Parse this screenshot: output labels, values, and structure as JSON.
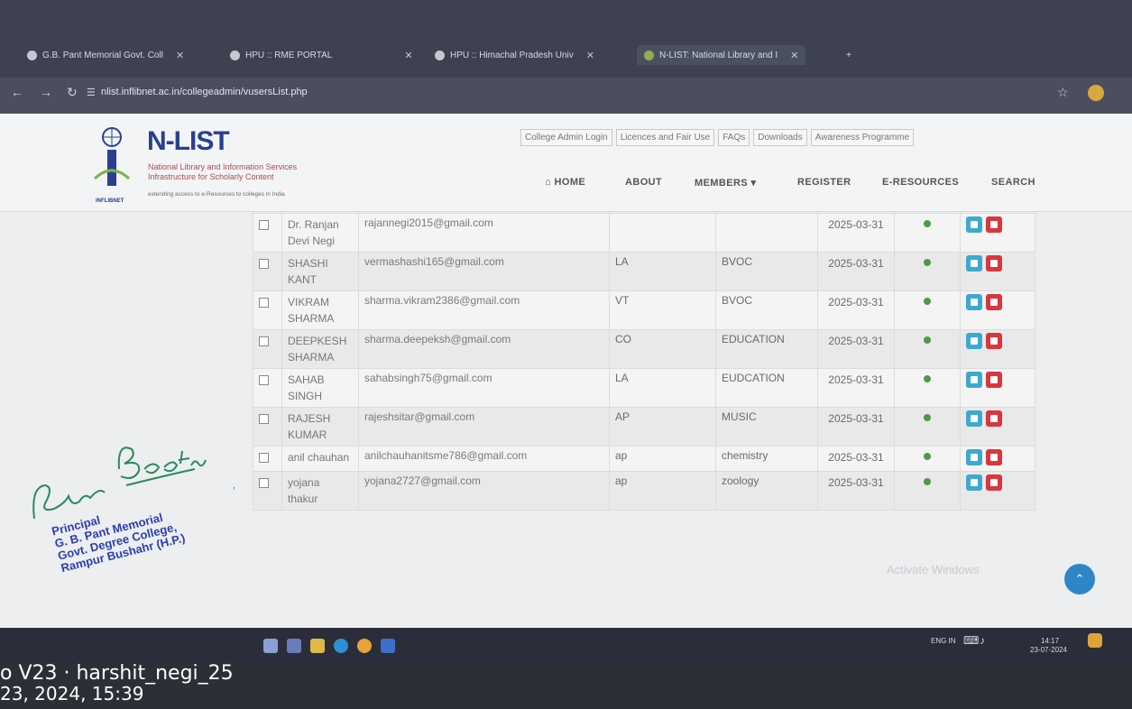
{
  "browser": {
    "tabs": [
      {
        "label": "G.B. Pant Memorial Govt. Coll"
      },
      {
        "label": "HPU :: RME PORTAL"
      },
      {
        "label": "HPU :: Himachal Pradesh Univ"
      },
      {
        "label": "N-LIST: National Library and I"
      }
    ],
    "url": "nlist.inflibnet.ac.in/collegeadmin/vusersList.php"
  },
  "site": {
    "logo_title": "N-LIST",
    "logo_sub1": "National Library and Information Services",
    "logo_sub2": "Infrastructure for Scholarly Content",
    "logo_tag": "extending access to e-Resources to colleges in India",
    "logo_brand": "INFLIBNET",
    "top_links": [
      "College Admin Login",
      "Licences and Fair Use",
      "FAQs",
      "Downloads",
      "Awareness Programme"
    ],
    "nav": {
      "home": "HOME",
      "about": "ABOUT",
      "members": "MEMBERS ▾",
      "register": "REGISTER",
      "eresources": "E-RESOURCES",
      "search": "SEARCH"
    }
  },
  "users": [
    {
      "name": "Dr. Ranjan Devi Negi",
      "email": "rajannegi2015@gmail.com",
      "category": "",
      "dept": "",
      "date": "2025-03-31"
    },
    {
      "name": "SHASHI KANT",
      "email": "vermashashi165@gmail.com",
      "category": "LA",
      "dept": "BVOC",
      "date": "2025-03-31"
    },
    {
      "name": "VIKRAM SHARMA",
      "email": "sharma.vikram2386@gmail.com",
      "category": "VT",
      "dept": "BVOC",
      "date": "2025-03-31"
    },
    {
      "name": "DEEPKESH SHARMA",
      "email": "sharma.deepeksh@gmail.com",
      "category": "CO",
      "dept": "EDUCATION",
      "date": "2025-03-31"
    },
    {
      "name": "SAHAB SINGH",
      "email": "sahabsingh75@gmail.com",
      "category": "LA",
      "dept": "EUDCATION",
      "date": "2025-03-31"
    },
    {
      "name": "RAJESH KUMAR",
      "email": "rajeshsitar@gmail.com",
      "category": "AP",
      "dept": "MUSIC",
      "date": "2025-03-31"
    },
    {
      "name": "anil chauhan",
      "email": "anilchauhanitsme786@gmail.com",
      "category": "ap",
      "dept": "chemistry",
      "date": "2025-03-31"
    },
    {
      "name": "yojana thakur",
      "email": "yojana2727@gmail.com",
      "category": "ap",
      "dept": "zoology",
      "date": "2025-03-31"
    }
  ],
  "overlay": {
    "watermark": "Activate Windows",
    "scroll_up": "⌃"
  },
  "taskbar": {
    "lang": "ENG IN",
    "time": "14:17",
    "date": "23-07-2024"
  },
  "stamp": {
    "line1": "Principal",
    "line2": "G. B. Pant Memorial",
    "line3": "Govt. Degree College,",
    "line4": "Rampur Bushahr (H.P.)"
  },
  "camera_watermark": {
    "line1": "o V23 · harshit_negi_25",
    "line2": "23, 2024, 15:39"
  },
  "colors": {
    "brand_blue": "#2a3f8f",
    "edit_button": "#3ea9cf",
    "delete_button": "#d9363e",
    "status_active": "#4b9b45"
  }
}
